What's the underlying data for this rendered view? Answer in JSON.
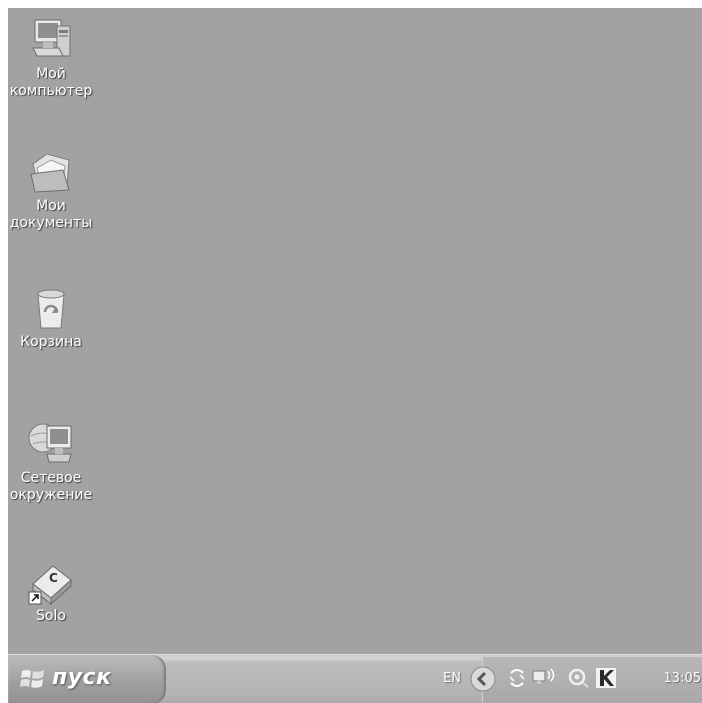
{
  "desktop": {
    "icons": [
      {
        "label": "Мой\nкомпьютер",
        "icon": "my-computer-icon"
      },
      {
        "label": "Мои\nдокументы",
        "icon": "my-documents-icon"
      },
      {
        "label": "Корзина",
        "icon": "recycle-bin-icon"
      },
      {
        "label": "Сетевое\nокружение",
        "icon": "network-places-icon"
      },
      {
        "label": "Solo",
        "icon": "solo-shortcut-icon"
      }
    ]
  },
  "taskbar": {
    "start_label": "пуск",
    "language": "EN",
    "clock": "13:05",
    "tray_icons": [
      "show-hidden-icons-icon",
      "recycle-process-icon",
      "network-connection-icon",
      "audio-icon",
      "kaspersky-icon"
    ]
  },
  "colors": {
    "desktop": "#a2a2a2",
    "taskbar": "#b3b3b3",
    "start_button": "#9e9e9e"
  }
}
